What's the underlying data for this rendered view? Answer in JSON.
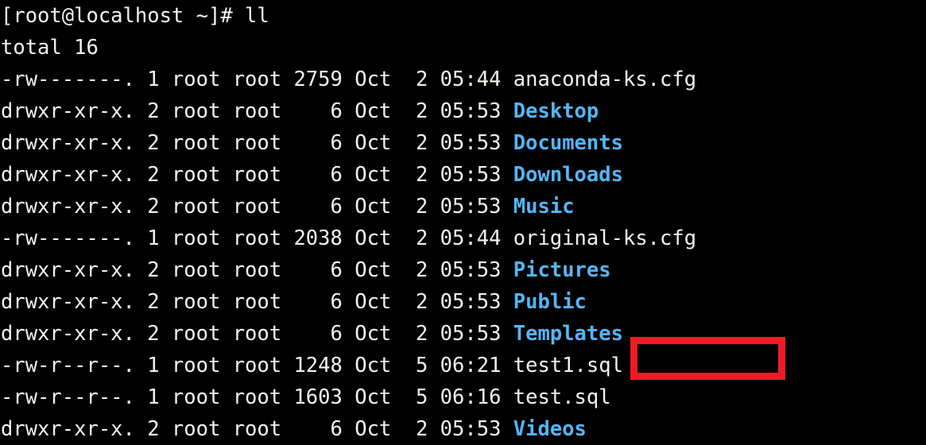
{
  "terminal": {
    "shell_prompt": "[root@localhost ~]# ",
    "command": "ll",
    "total_line": "total 16",
    "colors": {
      "background": "#000000",
      "foreground": "#f3f3ec",
      "directory": "#54b6f8",
      "highlight_box": "#ee1b24"
    },
    "columns": [
      "permissions",
      "links",
      "owner",
      "group",
      "size",
      "month",
      "day",
      "time",
      "name"
    ],
    "rows": [
      {
        "permissions": "-rw-------.",
        "links": "1",
        "owner": "root",
        "group": "root",
        "size": "2759",
        "month": "Oct",
        "day": "2",
        "time": "05:44",
        "name": "anaconda-ks.cfg",
        "type": "file"
      },
      {
        "permissions": "drwxr-xr-x.",
        "links": "2",
        "owner": "root",
        "group": "root",
        "size": "6",
        "month": "Oct",
        "day": "2",
        "time": "05:53",
        "name": "Desktop",
        "type": "dir"
      },
      {
        "permissions": "drwxr-xr-x.",
        "links": "2",
        "owner": "root",
        "group": "root",
        "size": "6",
        "month": "Oct",
        "day": "2",
        "time": "05:53",
        "name": "Documents",
        "type": "dir"
      },
      {
        "permissions": "drwxr-xr-x.",
        "links": "2",
        "owner": "root",
        "group": "root",
        "size": "6",
        "month": "Oct",
        "day": "2",
        "time": "05:53",
        "name": "Downloads",
        "type": "dir"
      },
      {
        "permissions": "drwxr-xr-x.",
        "links": "2",
        "owner": "root",
        "group": "root",
        "size": "6",
        "month": "Oct",
        "day": "2",
        "time": "05:53",
        "name": "Music",
        "type": "dir"
      },
      {
        "permissions": "-rw-------.",
        "links": "1",
        "owner": "root",
        "group": "root",
        "size": "2038",
        "month": "Oct",
        "day": "2",
        "time": "05:44",
        "name": "original-ks.cfg",
        "type": "file"
      },
      {
        "permissions": "drwxr-xr-x.",
        "links": "2",
        "owner": "root",
        "group": "root",
        "size": "6",
        "month": "Oct",
        "day": "2",
        "time": "05:53",
        "name": "Pictures",
        "type": "dir"
      },
      {
        "permissions": "drwxr-xr-x.",
        "links": "2",
        "owner": "root",
        "group": "root",
        "size": "6",
        "month": "Oct",
        "day": "2",
        "time": "05:53",
        "name": "Public",
        "type": "dir"
      },
      {
        "permissions": "drwxr-xr-x.",
        "links": "2",
        "owner": "root",
        "group": "root",
        "size": "6",
        "month": "Oct",
        "day": "2",
        "time": "05:53",
        "name": "Templates",
        "type": "dir"
      },
      {
        "permissions": "-rw-r--r--.",
        "links": "1",
        "owner": "root",
        "group": "root",
        "size": "1248",
        "month": "Oct",
        "day": "5",
        "time": "06:21",
        "name": "test1.sql",
        "type": "file",
        "highlighted": true
      },
      {
        "permissions": "-rw-r--r--.",
        "links": "1",
        "owner": "root",
        "group": "root",
        "size": "1603",
        "month": "Oct",
        "day": "5",
        "time": "06:16",
        "name": "test.sql",
        "type": "file"
      },
      {
        "permissions": "drwxr-xr-x.",
        "links": "2",
        "owner": "root",
        "group": "root",
        "size": "6",
        "month": "Oct",
        "day": "2",
        "time": "05:53",
        "name": "Videos",
        "type": "dir"
      }
    ]
  }
}
